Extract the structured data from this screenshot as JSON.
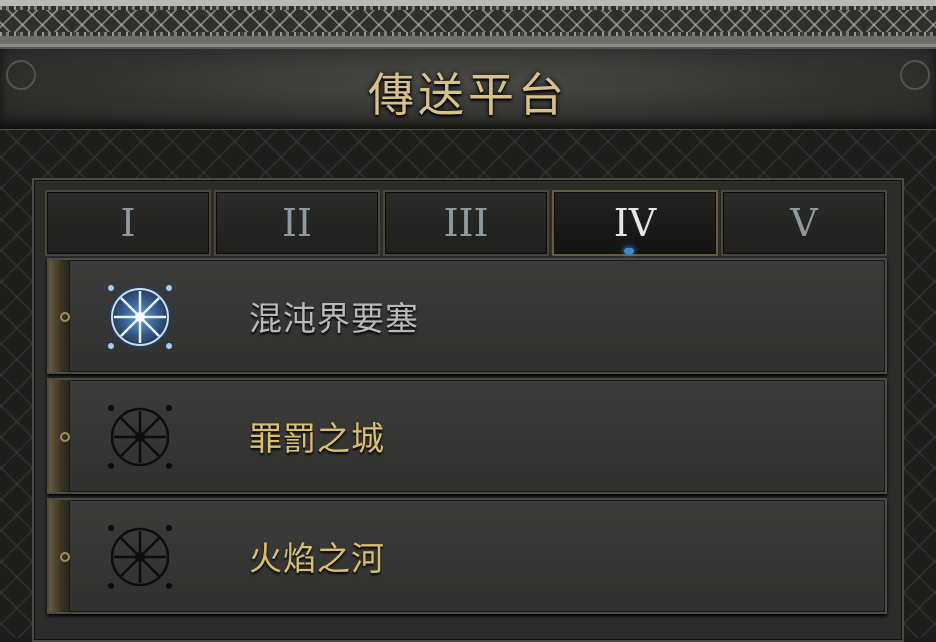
{
  "title": "傳送平台",
  "tabs": [
    {
      "label": "I",
      "active": false
    },
    {
      "label": "II",
      "active": false
    },
    {
      "label": "III",
      "active": false
    },
    {
      "label": "IV",
      "active": true
    },
    {
      "label": "V",
      "active": false
    }
  ],
  "waypoints": [
    {
      "label": "混沌界要塞",
      "state": "current",
      "icon": "waypoint-rune-glowing-icon"
    },
    {
      "label": "罪罰之城",
      "state": "available",
      "icon": "waypoint-rune-icon"
    },
    {
      "label": "火焰之河",
      "state": "available",
      "icon": "waypoint-rune-icon"
    }
  ],
  "colors": {
    "title": "#d8c08a",
    "current_label": "#b9b9b9",
    "available_label": "#d9bf6e",
    "glow": "#3f8ad8"
  }
}
